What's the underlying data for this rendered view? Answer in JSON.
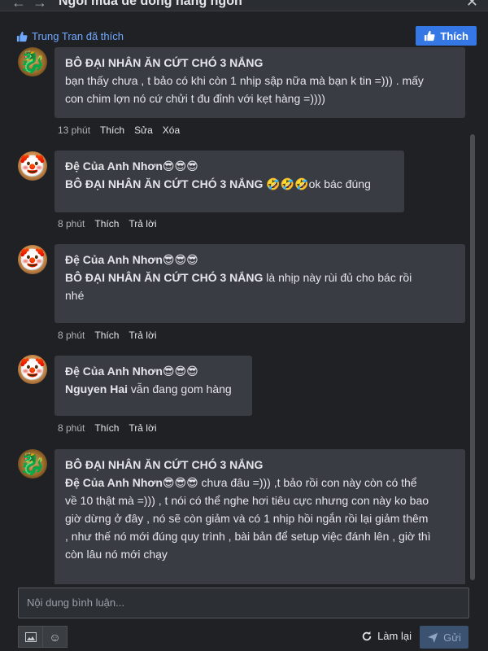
{
  "window": {
    "title": "Ngồi mua để đóng hàng ngon",
    "back_icon": "←",
    "forward_icon": "→",
    "close_icon": "✕"
  },
  "like_bar": {
    "liked_by": "Trung Tran đã thích",
    "like_button": "Thích"
  },
  "comments": [
    {
      "author": "BÔ ĐẠI NHÂN ĂN CỨT CHÓ 3 NẮNG",
      "author_emoji": "",
      "mention": "",
      "text_lines": [
        "bạn thấy chưa , t bảo có khi còn 1 nhịp sập nữa mà bạn k tin =))) . mấy",
        "con chim lợn nó cứ chửi t đu đỉnh với kẹt hàng =))))"
      ],
      "time": "13 phút",
      "actions": [
        "Thích",
        "Sửa",
        "Xóa"
      ]
    },
    {
      "author": "Đệ Của Anh Nhơn",
      "author_emoji": "😎😎😎",
      "mention": "BÔ ĐẠI NHÂN ĂN CỨT CHÓ 3 NẮNG",
      "text_lines": [
        "🤣🤣🤣ok bác đúng"
      ],
      "time": "8 phút",
      "actions": [
        "Thích",
        "Trả lời"
      ]
    },
    {
      "author": "Đệ Của Anh Nhơn",
      "author_emoji": "😎😎😎",
      "mention": "BÔ ĐẠI NHÂN ĂN CỨT CHÓ 3 NẮNG",
      "text_lines": [
        "là nhịp này rùi đủ cho bác rồi",
        "nhé"
      ],
      "time": "8 phút",
      "actions": [
        "Thích",
        "Trả lời"
      ]
    },
    {
      "author": "Đệ Của Anh Nhơn",
      "author_emoji": "😎😎😎",
      "mention": "Nguyen Hai",
      "text_lines": [
        "vẫn đang gom hàng"
      ],
      "time": "8 phút",
      "actions": [
        "Thích",
        "Trả lời"
      ]
    },
    {
      "author": "BÔ ĐẠI NHÂN ĂN CỨT CHÓ 3 NẮNG",
      "author_emoji": "",
      "mention": "Đệ Của Anh Nhơn😎😎😎",
      "text_lines": [
        " chưa đâu =))) ,t bảo rồi con này còn có thể",
        "về 10 thật mà =))) , t nói có thể nghe hơi tiêu cực nhưng con này ko bao",
        "giờ dừng ở đây , nó sẽ còn giảm và có 1 nhịp hồi ngắn rồi lại giảm thêm",
        ", như thế nó mới đúng quy trình , bài bản để setup việc đánh lên , giờ thì",
        "còn lâu nó mới chạy"
      ],
      "time": "",
      "actions": []
    }
  ],
  "composer": {
    "placeholder": "Nội dung bình luận...",
    "reload_label": "Làm lại",
    "send_label": "Gửi"
  },
  "colors": {
    "background": "#1f2125",
    "bubble": "#393c42",
    "accent": "#3578e5",
    "link": "#6fa8ff"
  }
}
